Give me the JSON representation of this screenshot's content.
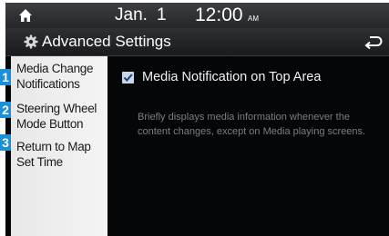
{
  "status_bar": {
    "home_icon": "home-icon",
    "date_month": "Jan.",
    "date_day": "1",
    "time": "12:00",
    "ampm": "AM"
  },
  "title_bar": {
    "gear_icon": "gear-icon",
    "title": "Advanced Settings",
    "back_icon": "back-arrow-icon"
  },
  "sidebar": {
    "items": [
      {
        "badge": "1",
        "label": "Media Change Notifications",
        "selected": true
      },
      {
        "badge": "2",
        "label": "Steering Wheel Mode Button",
        "selected": false
      },
      {
        "badge": "3",
        "label": "Return to Map Set Time",
        "selected": false
      }
    ]
  },
  "content": {
    "option_label": "Media Notification on Top Area",
    "option_checked": true,
    "description": "Briefly displays media information whenever the content changes, except on Media playing screens."
  },
  "colors": {
    "screen_bg": "#050608",
    "badge_blue": "#1c8fd6",
    "sidebar_bg": "#f0f0f0"
  }
}
